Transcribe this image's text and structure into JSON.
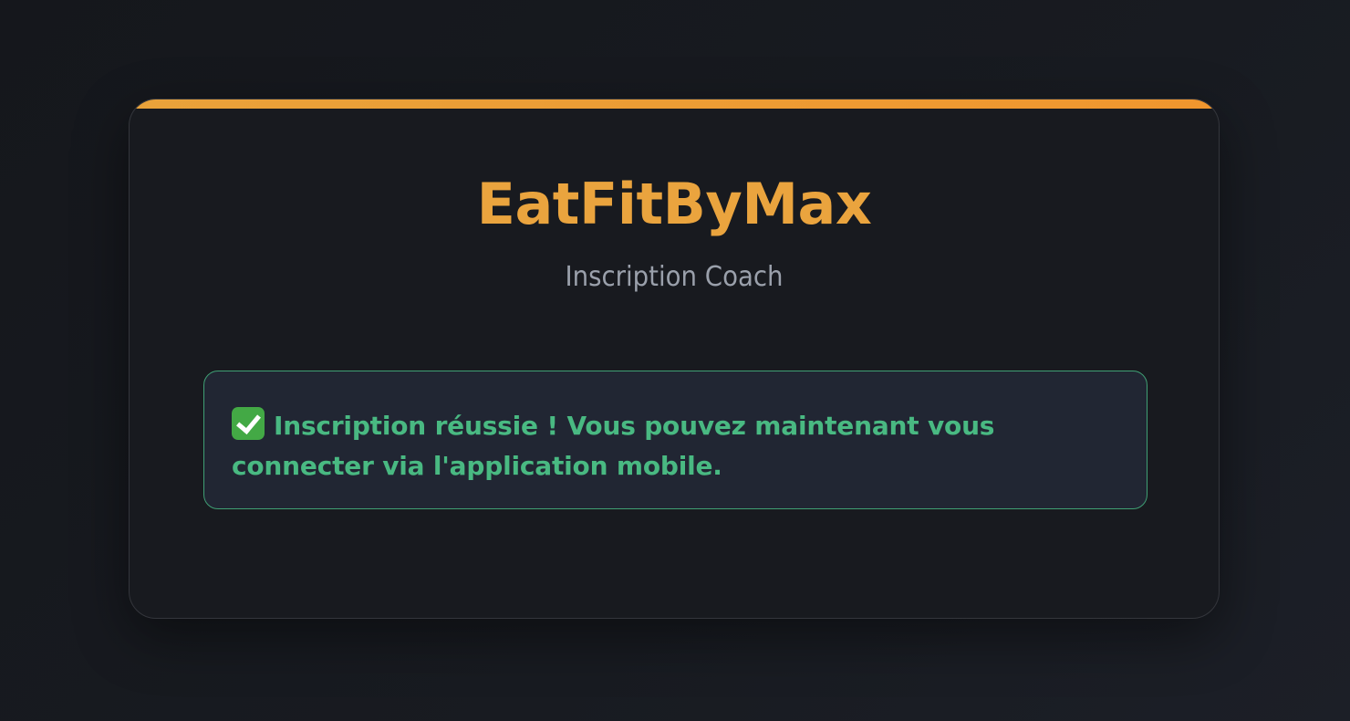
{
  "brand": {
    "name": "EatFitByMax",
    "subtitle": "Inscription Coach"
  },
  "alert": {
    "icon": "check-mark-icon",
    "line1": "Inscription réussie ! Vous pouvez maintenant vous",
    "line2": "connecter via l'application mobile."
  },
  "colors": {
    "accent": "#EAA43E",
    "success": "#49B982",
    "background": "#181A1F"
  }
}
